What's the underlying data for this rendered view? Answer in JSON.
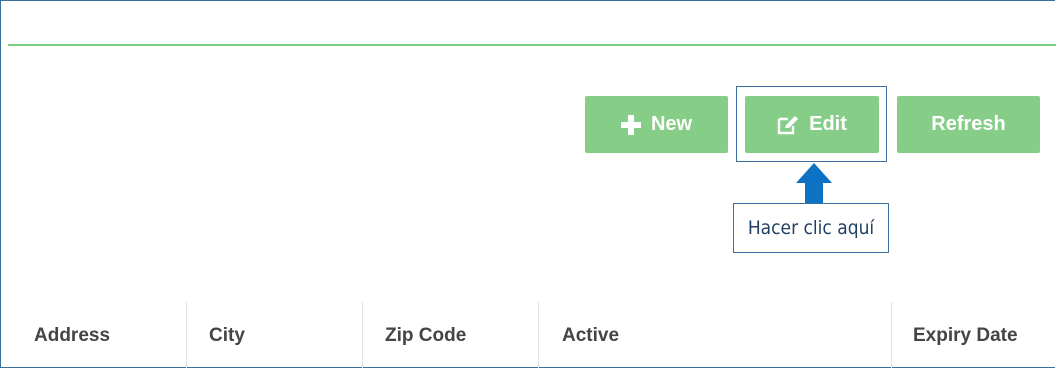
{
  "toolbar": {
    "new_label": "New",
    "edit_label": "Edit",
    "refresh_label": "Refresh"
  },
  "annotation": {
    "callout_text": "Hacer clic aquí"
  },
  "table": {
    "columns": [
      "Address",
      "City",
      "Zip Code",
      "Active",
      "Expiry Date"
    ]
  },
  "icons": {
    "new": "plus-icon",
    "edit": "edit-pencil-icon",
    "pointer": "arrow-up-icon"
  },
  "colors": {
    "button_green": "#86cd88",
    "header_line": "#7ccf7e",
    "annotation_blue": "#0b72c4",
    "annotation_border": "#3a6e9c"
  }
}
